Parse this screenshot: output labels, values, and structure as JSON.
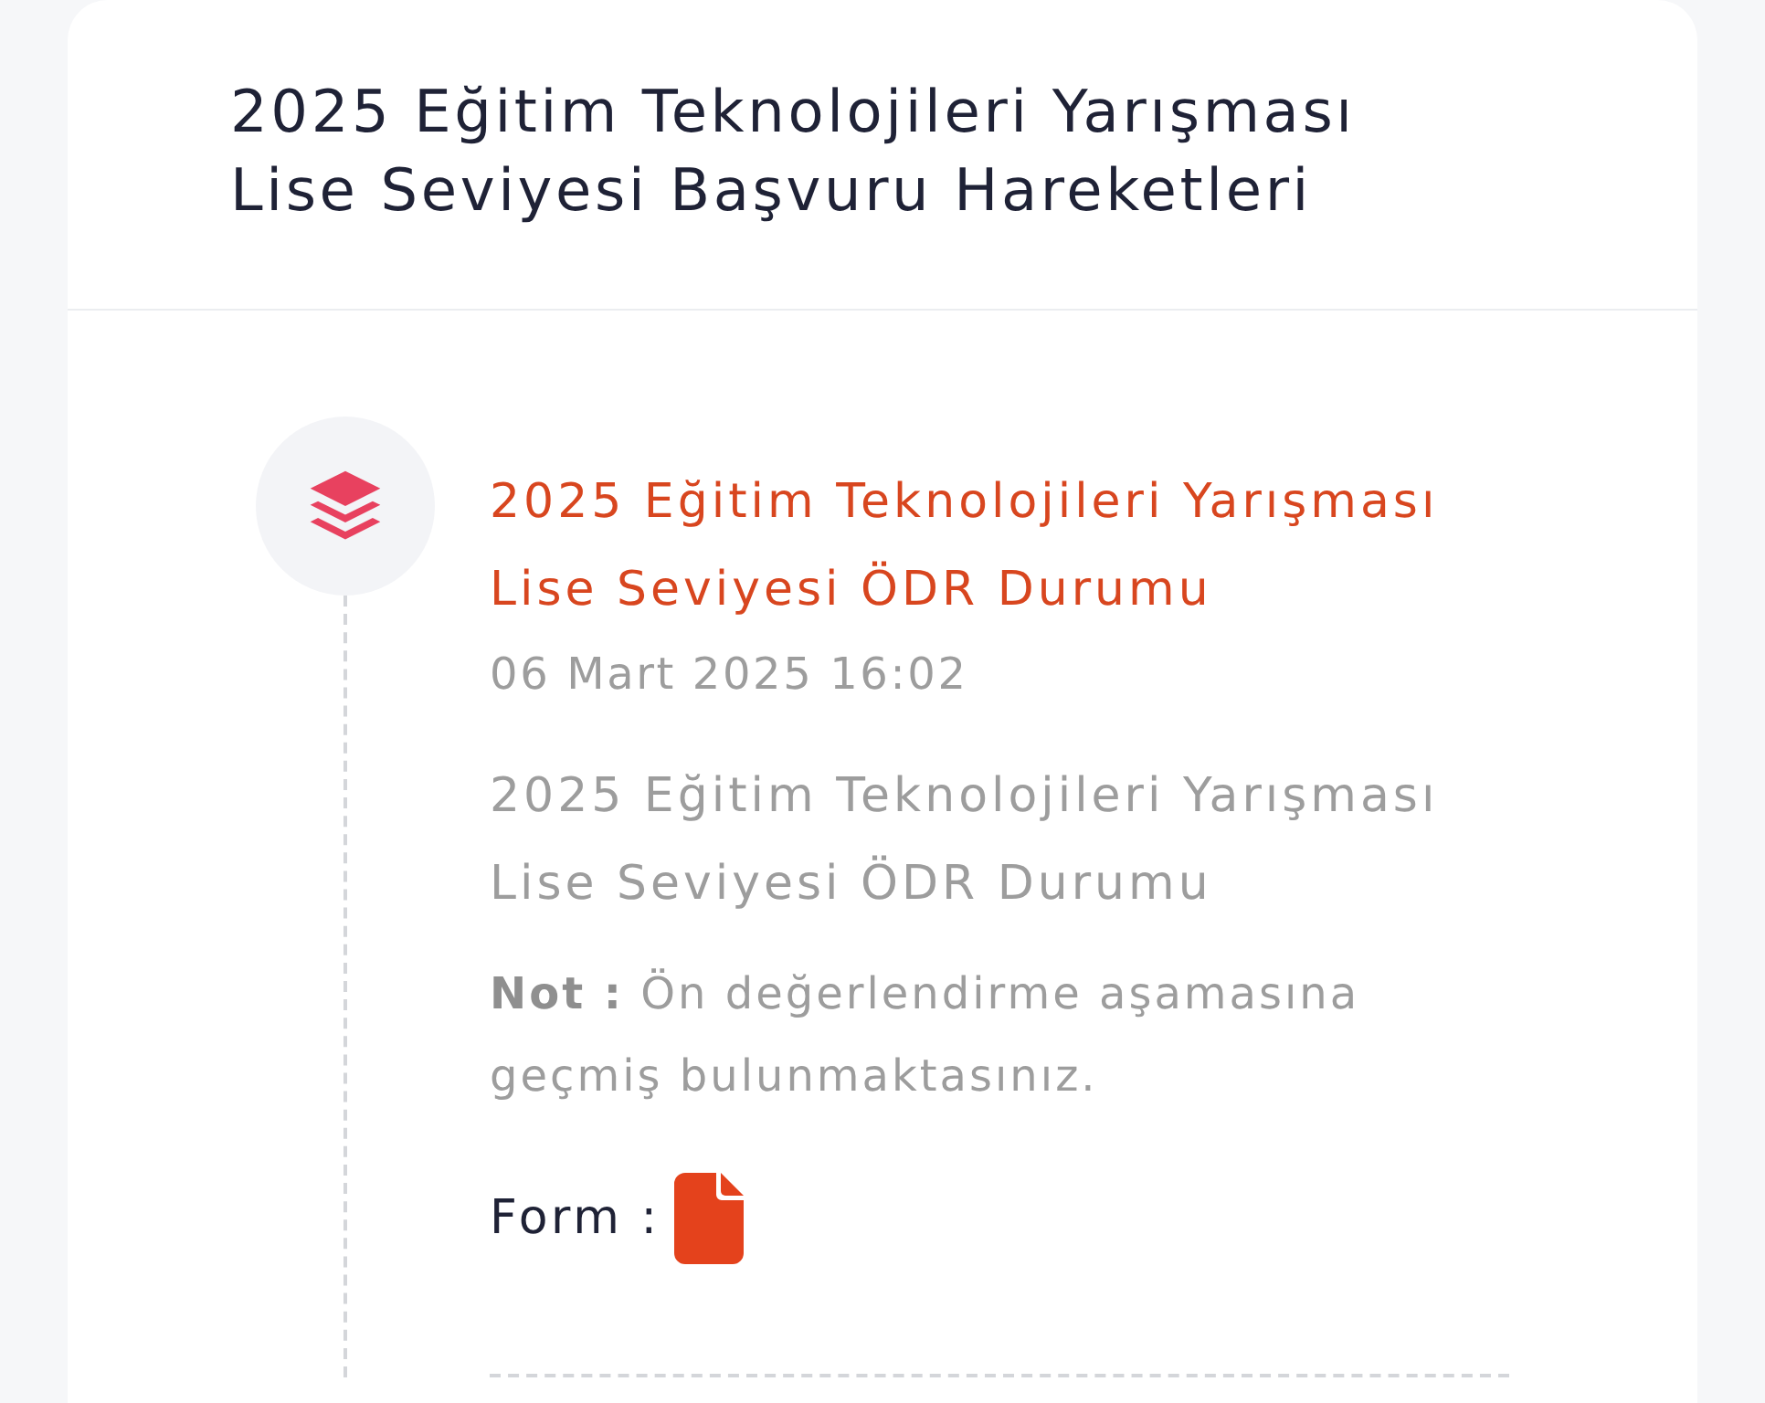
{
  "page": {
    "title": "2025 Eğitim Teknolojileri Yarışması Lise Seviyesi Başvuru Hareketleri"
  },
  "timeline": [
    {
      "title": "2025 Eğitim Teknolojileri Yarışması Lise Seviyesi ÖDR Durumu",
      "date": "06 Mart 2025 16:02",
      "description": "2025 Eğitim Teknolojileri Yarışması Lise Seviyesi ÖDR Durumu",
      "note": "**Not :** Ön değerlendirme aşamasına geçmiş bulunmaktasınız.",
      "form_label": "Form :"
    }
  ]
}
